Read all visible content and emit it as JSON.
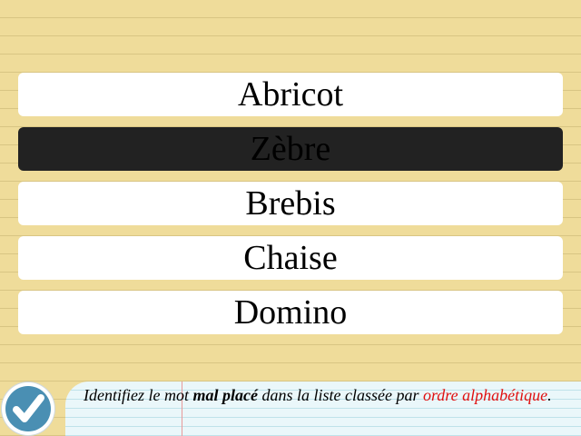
{
  "words": [
    {
      "label": "Abricot",
      "selected": false
    },
    {
      "label": "Zèbre",
      "selected": true
    },
    {
      "label": "Brebis",
      "selected": false
    },
    {
      "label": "Chaise",
      "selected": false
    },
    {
      "label": "Domino",
      "selected": false
    }
  ],
  "instruction": {
    "part1": "Identifiez le mot ",
    "emphasis": "mal placé",
    "part2": " dans la liste classée par ",
    "highlight": "ordre alphabétique",
    "part3": "."
  },
  "check_button": {
    "icon": "check-icon"
  },
  "colors": {
    "paper": "#efdc9a",
    "selected_bg": "#222222",
    "accent": "#e01010",
    "check_blue": "#4a8fb3"
  }
}
